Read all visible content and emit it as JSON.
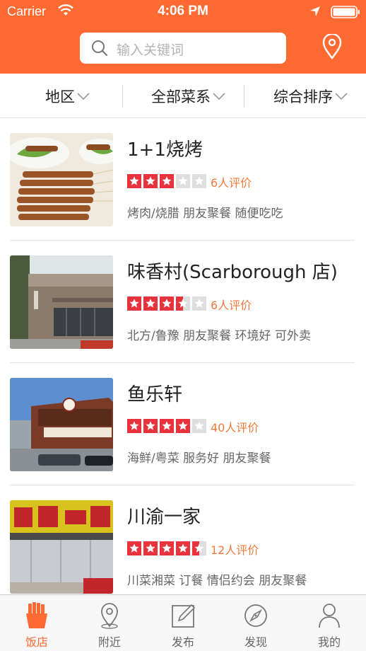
{
  "status_bar": {
    "carrier": "Carrier",
    "time": "4:06 PM"
  },
  "header": {
    "search_placeholder": "输入关键词",
    "location_icon": "map-pin-icon"
  },
  "filters": [
    {
      "label": "地区"
    },
    {
      "label": "全部菜系"
    },
    {
      "label": "综合排序"
    }
  ],
  "restaurants": [
    {
      "name": "1+1烧烤",
      "rating": 3,
      "reviews": "6人评价",
      "tags": "烤肉/烧腊  朋友聚餐  随便吃吃"
    },
    {
      "name": "味香村(Scarborough 店)",
      "rating": 3.5,
      "reviews": "6人评价",
      "tags": "北方/鲁豫  朋友聚餐  环境好  可外卖"
    },
    {
      "name": "鱼乐轩",
      "rating": 4,
      "reviews": "40人评价",
      "tags": "海鲜/粤菜  服务好  朋友聚餐"
    },
    {
      "name": "川渝一家",
      "rating": 4.5,
      "reviews": "12人评价",
      "tags": "川菜湘菜  订餐  情侣约会  朋友聚餐"
    }
  ],
  "tabs": [
    {
      "label": "饭店",
      "icon": "fries-icon",
      "active": true
    },
    {
      "label": "附近",
      "icon": "location-pin-icon",
      "active": false
    },
    {
      "label": "发布",
      "icon": "edit-icon",
      "active": false
    },
    {
      "label": "发现",
      "icon": "compass-icon",
      "active": false
    },
    {
      "label": "我的",
      "icon": "person-icon",
      "active": false
    }
  ],
  "colors": {
    "brand": "#ff6a32",
    "star": "#e8323c",
    "star_empty": "#dedede",
    "review_text": "#f07a3b"
  }
}
